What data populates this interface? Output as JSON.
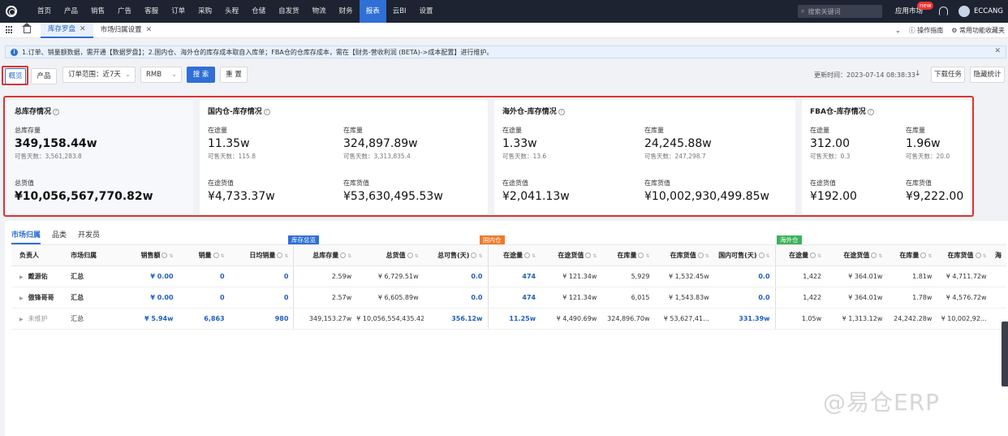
{
  "topnav": {
    "menu": [
      "首页",
      "产品",
      "销售",
      "广告",
      "客服",
      "订单",
      "采购",
      "头程",
      "仓储",
      "自发货",
      "物流",
      "财务",
      "报表",
      "云BI",
      "设置"
    ],
    "active_index": 12,
    "search_placeholder": "搜索关键词",
    "app_market": "应用市场",
    "new_badge": "new",
    "username": "ECCANG"
  },
  "tabbar": {
    "tabs": [
      {
        "label": "库存罗盘",
        "active": true
      },
      {
        "label": "市场归属设置",
        "active": false
      }
    ],
    "guide": "操作指南",
    "favorites": "常用功能收藏夹"
  },
  "notice": {
    "text": "1.订单、销量额数据，需开通【数据罗盘】；2.国内仓、海外仓的库存成本取自入库单；FBA仓的仓库存成本，需在【财务-营收利润 (BETA)->成本配置】进行维护。"
  },
  "toolbar": {
    "tab_overview": "概览",
    "tab_product": "产品",
    "order_range_label": "订单范围：近7天",
    "currency": "RMB",
    "search_btn": "搜 索",
    "reset_btn": "重 置",
    "update_time": "更新时间：2023-07-14 08:38:33",
    "download_btn": "下载任务",
    "hide_stats_btn": "隐藏统计"
  },
  "summary": {
    "total": {
      "title": "总库存情况",
      "stock_label": "总库存量",
      "stock_value": "349,158.44w",
      "stock_days": "可售天数：3,561,283.8",
      "value_label": "总货值",
      "value_value": "¥10,056,567,770.82w"
    },
    "domestic": {
      "title": "国内仓-库存情况",
      "transit_label": "在途量",
      "transit_value": "11.35w",
      "transit_days": "可售天数：115.8",
      "instock_label": "在库量",
      "instock_value": "324,897.89w",
      "instock_days": "可售天数：3,313,835.4",
      "transit_goods_label": "在途货值",
      "transit_goods_value": "¥4,733.37w",
      "instock_goods_label": "在库货值",
      "instock_goods_value": "¥53,630,495.53w"
    },
    "overseas": {
      "title": "海外仓-库存情况",
      "transit_label": "在途量",
      "transit_value": "1.33w",
      "transit_days": "可售天数：13.6",
      "instock_label": "在库量",
      "instock_value": "24,245.88w",
      "instock_days": "可售天数：247,298.7",
      "transit_goods_label": "在途货值",
      "transit_goods_value": "¥2,041.13w",
      "instock_goods_label": "在库货值",
      "instock_goods_value": "¥10,002,930,499.85w"
    },
    "fba": {
      "title": "FBA仓-库存情况",
      "transit_label": "在途量",
      "transit_value": "312.00",
      "transit_days": "可售天数：0.3",
      "instock_label": "在库量",
      "instock_value": "1.96w",
      "instock_days": "可售天数：20.0",
      "transit_goods_label": "在途货值",
      "transit_goods_value": "¥192.00",
      "instock_goods_label": "在库货值",
      "instock_goods_value": "¥9,222.00"
    }
  },
  "subtabs": [
    "市场归属",
    "品类",
    "开发员"
  ],
  "groups": {
    "total": "库存总览",
    "domestic": "国内仓",
    "overseas": "海外仓"
  },
  "table": {
    "headers": [
      "负责人",
      "市场归属",
      "销售额",
      "销量",
      "日均销量",
      "总库存量",
      "总货值",
      "总可售(天)",
      "在途量",
      "在途货值",
      "在库量",
      "在库货值",
      "国内可售(天)",
      "在途量",
      "在途货值",
      "在库量",
      "在库货值",
      "海"
    ],
    "rows": [
      [
        "戴源佑",
        "汇总",
        "¥ 0.00",
        "0",
        "0",
        "2.59w",
        "¥ 6,729.51w",
        "0.0",
        "474",
        "¥ 121.34w",
        "5,929",
        "¥ 1,532.45w",
        "0.0",
        "1,422",
        "¥ 364.01w",
        "1.81w",
        "¥ 4,711.72w",
        ""
      ],
      [
        "傲锋哥哥",
        "汇总",
        "¥ 0.00",
        "0",
        "0",
        "2.57w",
        "¥ 6,605.89w",
        "0.0",
        "474",
        "¥ 121.34w",
        "6,015",
        "¥ 1,543.83w",
        "0.0",
        "1,422",
        "¥ 364.01w",
        "1.78w",
        "¥ 4,576.72w",
        ""
      ],
      [
        "未维护",
        "汇总",
        "¥ 5.94w",
        "6,863",
        "980",
        "349,153.27w",
        "¥ 10,056,554,435.42",
        "356.12w",
        "11.25w",
        "¥ 4,490.69w",
        "324,896.70w",
        "¥ 53,627,41...",
        "331.39w",
        "1.05w",
        "¥ 1,313.12w",
        "24,242.28w",
        "¥ 10,002,92...",
        ""
      ]
    ]
  },
  "watermark": "@易仓ERP"
}
